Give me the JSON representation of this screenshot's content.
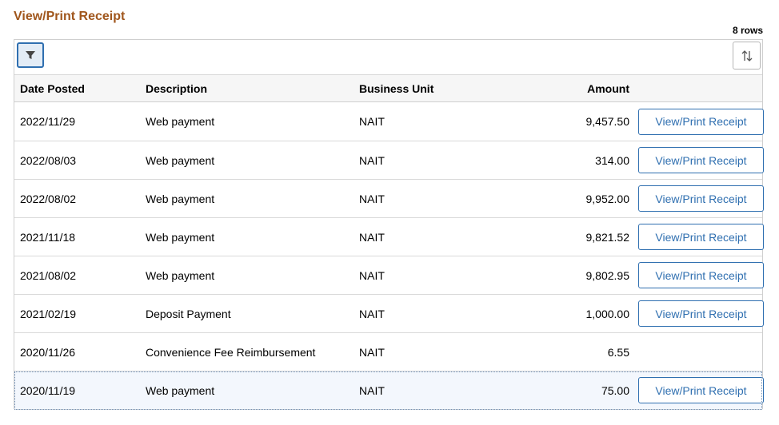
{
  "page": {
    "title": "View/Print Receipt",
    "row_count": "8 rows"
  },
  "toolbar": {
    "filter_icon": "filter-funnel-icon",
    "sort_icon": "sort-arrows-icon"
  },
  "columns": {
    "date": "Date Posted",
    "description": "Description",
    "business_unit": "Business Unit",
    "amount": "Amount"
  },
  "rows": [
    {
      "date": "2022/11/29",
      "description": "Web payment",
      "business_unit": "NAIT",
      "amount": "9,457.50",
      "action": "View/Print Receipt"
    },
    {
      "date": "2022/08/03",
      "description": "Web payment",
      "business_unit": "NAIT",
      "amount": "314.00",
      "action": "View/Print Receipt"
    },
    {
      "date": "2022/08/02",
      "description": "Web payment",
      "business_unit": "NAIT",
      "amount": "9,952.00",
      "action": "View/Print Receipt"
    },
    {
      "date": "2021/11/18",
      "description": "Web payment",
      "business_unit": "NAIT",
      "amount": "9,821.52",
      "action": "View/Print Receipt"
    },
    {
      "date": "2021/08/02",
      "description": "Web payment",
      "business_unit": "NAIT",
      "amount": "9,802.95",
      "action": "View/Print Receipt"
    },
    {
      "date": "2021/02/19",
      "description": "Deposit Payment",
      "business_unit": "NAIT",
      "amount": "1,000.00",
      "action": "View/Print Receipt"
    },
    {
      "date": "2020/11/26",
      "description": "Convenience Fee Reimbursement",
      "business_unit": "NAIT",
      "amount": "6.55",
      "action": null
    },
    {
      "date": "2020/11/19",
      "description": "Web payment",
      "business_unit": "NAIT",
      "amount": "75.00",
      "action": "View/Print Receipt"
    }
  ],
  "colors": {
    "title": "#a0561c",
    "accent": "#2f6fb0"
  }
}
